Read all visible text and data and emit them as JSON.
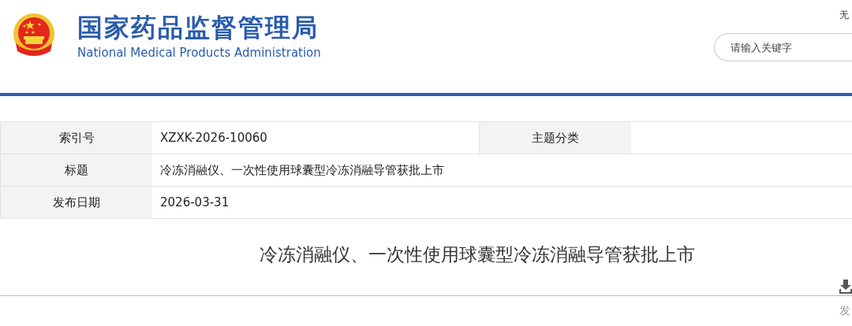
{
  "header": {
    "title": "国家药品监督管理局",
    "subtitle": "National Medical Products Administration",
    "accessibility_link": "无",
    "search": {
      "placeholder": "请输入关键字"
    }
  },
  "info_table": {
    "rows": [
      {
        "cells": [
          {
            "kind": "label",
            "text": "索引号"
          },
          {
            "kind": "value",
            "text": "XZXK-2026-10060"
          },
          {
            "kind": "label",
            "text": "主题分类"
          },
          {
            "kind": "blank"
          }
        ]
      },
      {
        "cells": [
          {
            "kind": "label",
            "text": "标题"
          },
          {
            "kind": "wide",
            "text": "冷冻消融仪、一次性使用球囊型冷冻消融导管获批上市"
          }
        ]
      },
      {
        "cells": [
          {
            "kind": "label",
            "text": "发布日期"
          },
          {
            "kind": "wide",
            "text": "2026-03-31"
          }
        ]
      }
    ]
  },
  "article": {
    "title": "冷冻消融仪、一次性使用球囊型冷冻消融导管获批上市",
    "meta_fragment": "发"
  }
}
